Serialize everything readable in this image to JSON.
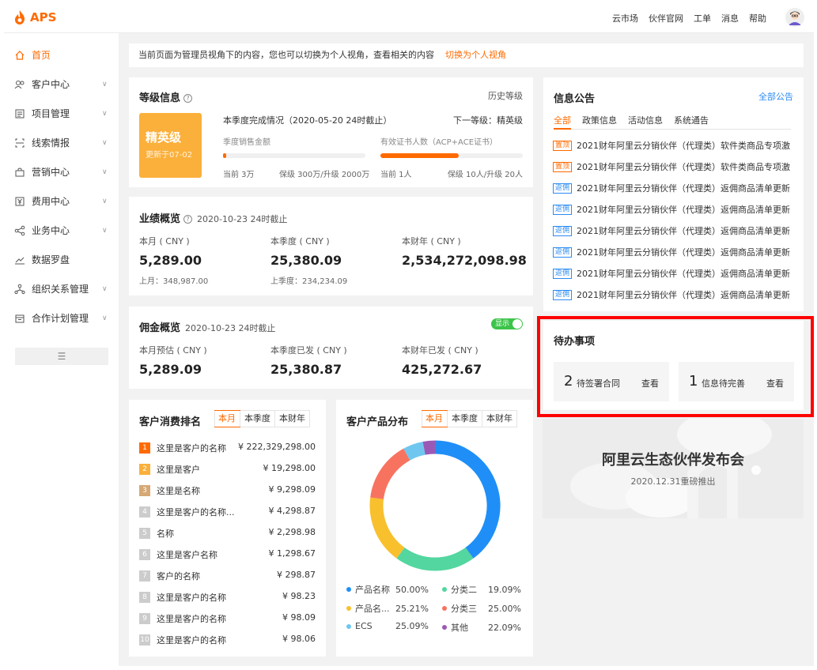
{
  "header": {
    "logo": "APS",
    "nav": [
      "云市场",
      "伙伴官网",
      "工单",
      "消息",
      "帮助"
    ]
  },
  "sidebar": {
    "items": [
      {
        "label": "首页",
        "icon": "home-icon",
        "active": true,
        "chevron": false
      },
      {
        "label": "客户中心",
        "icon": "users-icon",
        "chevron": true
      },
      {
        "label": "项目管理",
        "icon": "document-icon",
        "chevron": true
      },
      {
        "label": "线索情报",
        "icon": "scan-icon",
        "chevron": true
      },
      {
        "label": "营销中心",
        "icon": "bag-icon",
        "chevron": true
      },
      {
        "label": "费用中心",
        "icon": "yen-icon",
        "chevron": true
      },
      {
        "label": "业务中心",
        "icon": "share-icon",
        "chevron": true
      },
      {
        "label": "数据罗盘",
        "icon": "chart-line-icon",
        "chevron": false
      },
      {
        "label": "组织关系管理",
        "icon": "org-icon",
        "chevron": true
      },
      {
        "label": "合作计划管理",
        "icon": "calendar-icon",
        "chevron": true
      }
    ]
  },
  "notice": {
    "text": "当前页面为管理员视角下的内容，您也可以切换为个人视角，查看相关的内容",
    "link": "切换为个人视角"
  },
  "level": {
    "title": "等级信息",
    "history": "历史等级",
    "badge": "精英级",
    "expire": "更新于07-02",
    "quarter": "本季度完成情况（2020-05-20 24时截止）",
    "next": "下一等级：精英级",
    "sales_label": "季度销售金额",
    "sales_current": "当前 3万",
    "sales_range": "保级 300万/升级 2000万",
    "sales_progress": 0.02,
    "cert_label": "有效证书人数（ACP+ACE证书）",
    "cert_current": "当前 1人",
    "cert_range": "保级 10人/升级 20人",
    "cert_progress": 0.55
  },
  "perf": {
    "title": "业绩概览",
    "date": "2020-10-23 24时截止",
    "month_label": "本月 ( CNY )",
    "month_value": "5,289.00",
    "month_prev": "上月：348,987.00",
    "quarter_label": "本季度 ( CNY )",
    "quarter_value": "25,380.09",
    "quarter_prev": "上季度：234,234.09",
    "year_label": "本财年 ( CNY )",
    "year_value": "2,534,272,098.98"
  },
  "commission": {
    "title": "佣金概览",
    "date": "2020-10-23 24时截止",
    "toggle": "显示",
    "month_label": "本月预估 ( CNY )",
    "month_value": "5,289.09",
    "quarter_label": "本季度已发 ( CNY )",
    "quarter_value": "25,380.87",
    "year_label": "本财年已发 ( CNY )",
    "year_value": "425,272.67"
  },
  "ranking": {
    "title": "客户消费排名",
    "tabs": [
      "本月",
      "本季度",
      "本财年"
    ],
    "rows": [
      {
        "n": "1",
        "name": "这里是客户的名称",
        "value": "¥ 222,329,298.00",
        "color": "#ff6a00"
      },
      {
        "n": "2",
        "name": "这里是客户",
        "value": "¥ 19,298.00",
        "color": "#fbb03b"
      },
      {
        "n": "3",
        "name": "这里是名称",
        "value": "¥ 9,298.09",
        "color": "#d6a874"
      },
      {
        "n": "4",
        "name": "这里是客户的名称...",
        "value": "¥ 4,298.87",
        "color": "#cccccc"
      },
      {
        "n": "5",
        "name": "名称",
        "value": "¥ 2,298.98",
        "color": "#cccccc"
      },
      {
        "n": "6",
        "name": "这里是客户名称",
        "value": "¥ 1,298.67",
        "color": "#cccccc"
      },
      {
        "n": "7",
        "name": "客户的名称",
        "value": "¥ 298.87",
        "color": "#cccccc"
      },
      {
        "n": "8",
        "name": "这里是客户的名称",
        "value": "¥ 98.23",
        "color": "#cccccc"
      },
      {
        "n": "9",
        "name": "这里是客户的名称",
        "value": "¥ 98.09",
        "color": "#cccccc"
      },
      {
        "n": "10",
        "name": "这里是客户的名称",
        "value": "¥ 98.06",
        "color": "#cccccc"
      }
    ]
  },
  "distribution": {
    "title": "客户产品分布",
    "tabs": [
      "本月",
      "本季度",
      "本财年"
    ],
    "legend": [
      {
        "name": "产品名称",
        "pct": "50.00%",
        "color": "#1f8ff7"
      },
      {
        "name": "分类二",
        "pct": "19.09%",
        "color": "#53d6a0"
      },
      {
        "name": "产品名...",
        "pct": "25.21%",
        "color": "#f9c02d"
      },
      {
        "name": "分类三",
        "pct": "25.00%",
        "color": "#f8735f"
      },
      {
        "name": "ECS",
        "pct": "25.09%",
        "color": "#6fc7ef"
      },
      {
        "name": "其他",
        "pct": "22.09%",
        "color": "#9b59b6"
      }
    ]
  },
  "chart_data": {
    "type": "pie",
    "categories": [
      "产品名称",
      "分类二",
      "产品名...",
      "分类三",
      "ECS",
      "其他"
    ],
    "values": [
      40,
      20,
      17,
      15,
      5,
      3
    ],
    "colors": [
      "#1f8ff7",
      "#53d6a0",
      "#f9c02d",
      "#f8735f",
      "#6fc7ef",
      "#9b59b6"
    ],
    "title": "客户产品分布"
  },
  "news": {
    "title": "信息公告",
    "all": "全部公告",
    "tabs": [
      "全部",
      "政策信息",
      "活动信息",
      "系统通告"
    ],
    "items": [
      {
        "tag": "置顶",
        "type": "top",
        "text": "2021财年阿里云分销伙伴（代理类）软件类商品专项激"
      },
      {
        "tag": "置顶",
        "type": "top",
        "text": "2021财年阿里云分销伙伴（代理类）软件类商品专项激"
      },
      {
        "tag": "返佣",
        "type": "ret",
        "text": "2021财年阿里云分销伙伴（代理类）返佣商品清单更新"
      },
      {
        "tag": "返佣",
        "type": "ret",
        "text": "2021财年阿里云分销伙伴（代理类）返佣商品清单更新"
      },
      {
        "tag": "返佣",
        "type": "ret",
        "text": "2021财年阿里云分销伙伴（代理类）返佣商品清单更新"
      },
      {
        "tag": "返佣",
        "type": "ret",
        "text": "2021财年阿里云分销伙伴（代理类）返佣商品清单更新"
      },
      {
        "tag": "返佣",
        "type": "ret",
        "text": "2021财年阿里云分销伙伴（代理类）返佣商品清单更新"
      },
      {
        "tag": "返佣",
        "type": "ret",
        "text": "2021财年阿里云分销伙伴（代理类）返佣商品清单更新"
      }
    ]
  },
  "todo": {
    "title": "待办事项",
    "a_count": "2",
    "a_label": "待签署合同",
    "a_link": "查看",
    "b_count": "1",
    "b_label": "信息待完善",
    "b_link": "查看"
  },
  "banner": {
    "title": "阿里云生态伙伴发布会",
    "date": "2020.12.31重磅推出"
  }
}
